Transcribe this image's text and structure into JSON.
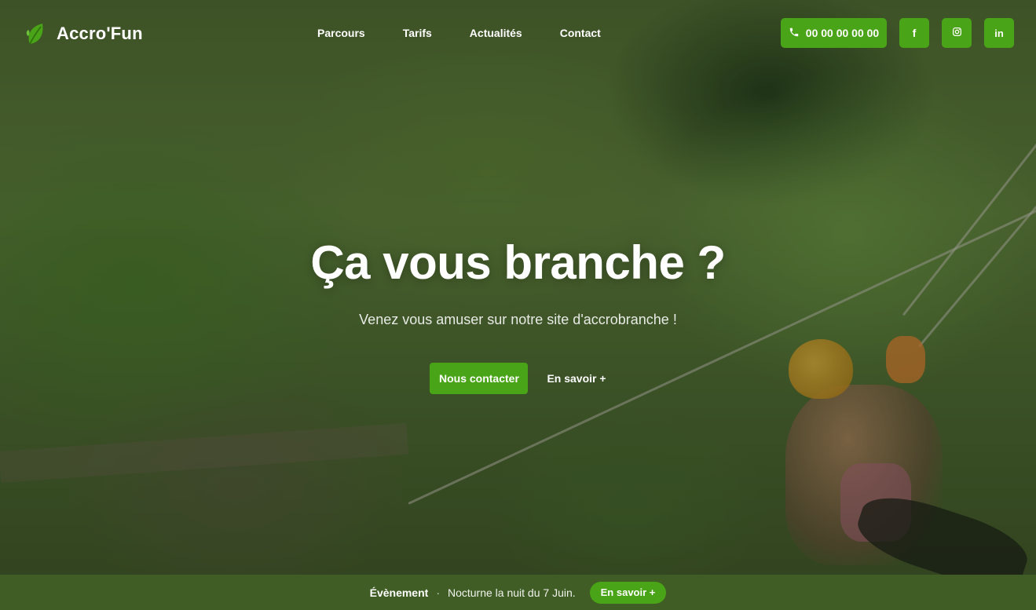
{
  "brand": {
    "name": "Accro'Fun",
    "accent": "#4aa417"
  },
  "nav": {
    "items": [
      {
        "label": "Parcours"
      },
      {
        "label": "Tarifs"
      },
      {
        "label": "Actualités"
      },
      {
        "label": "Contact"
      }
    ]
  },
  "header_actions": {
    "phone": "00 00 00 00 00",
    "social": [
      {
        "icon": "facebook-icon",
        "glyph": "f"
      },
      {
        "icon": "instagram-icon",
        "glyph": "◎"
      },
      {
        "icon": "linkedin-icon",
        "glyph": "in"
      }
    ]
  },
  "hero": {
    "title": "Ça vous branche ?",
    "subtitle": "Venez vous amuser sur notre site d'accrobranche !",
    "primary_cta": "Nous contacter",
    "secondary_cta": "En savoir +"
  },
  "event": {
    "label": "Évènement",
    "separator": "·",
    "text": "Nocturne la nuit du 7 Juin.",
    "cta": "En savoir +",
    "bar_color": "#3f5d24"
  }
}
